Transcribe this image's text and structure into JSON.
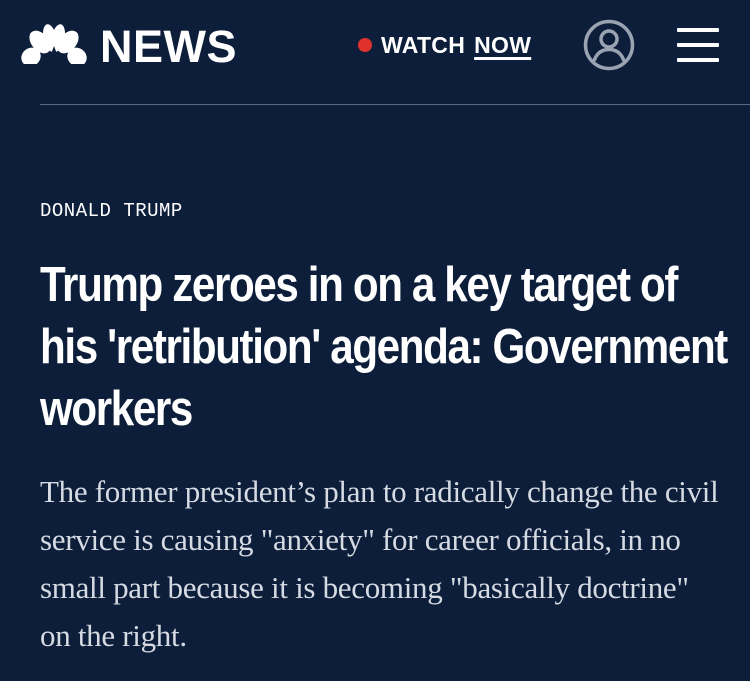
{
  "header": {
    "logo_text": "NEWS",
    "watch_label": "WATCH",
    "watch_now": "NOW",
    "live_dot_color": "#e0322d",
    "account_icon": "user-circle-icon",
    "menu_icon": "hamburger-menu-icon"
  },
  "article": {
    "kicker": "DONALD TRUMP",
    "headline": "Trump zeroes in on a key target of his 'retribution' agenda: Government workers",
    "dek": "The former president’s plan to radically change the civil service is causing \"anxiety\" for career officials, in no small part because it is becoming \"basically doctrine\" on the right."
  },
  "colors": {
    "background": "#0d1e3a",
    "text": "#ffffff",
    "dek_text": "#d6dbe3",
    "divider": "#5a6a86"
  }
}
